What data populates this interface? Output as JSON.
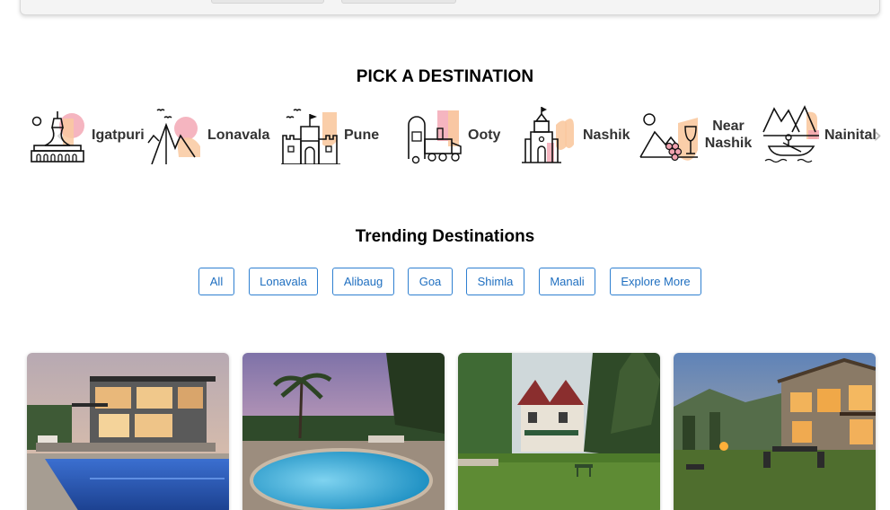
{
  "pick_section": {
    "title": "PICK A DESTINATION",
    "destinations": [
      {
        "label": "Igatpuri",
        "icon": "pagoda-icon"
      },
      {
        "label": "Lonavala",
        "icon": "mountain-birds-icon"
      },
      {
        "label": "Pune",
        "icon": "fort-icon"
      },
      {
        "label": "Ooty",
        "icon": "toy-train-icon"
      },
      {
        "label": "Nashik",
        "icon": "temple-icon"
      },
      {
        "label": "Near Nashik",
        "icon": "grapes-wine-icon"
      },
      {
        "label": "Nainital",
        "icon": "boat-lake-icon"
      }
    ]
  },
  "trending_section": {
    "title": "Trending Destinations",
    "tabs": [
      "All",
      "Lonavala",
      "Alibaug",
      "Goa",
      "Shimla",
      "Manali",
      "Explore More"
    ]
  },
  "colors": {
    "accent_blue": "#2f80d1",
    "icon_peach": "#f9c9a0",
    "icon_pink": "#f2a3b0"
  }
}
